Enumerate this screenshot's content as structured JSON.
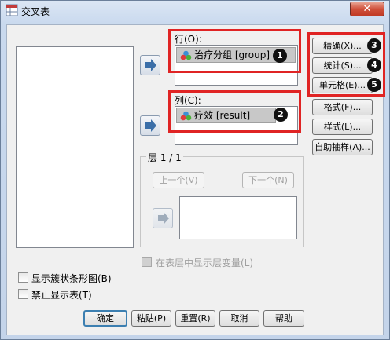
{
  "window": {
    "title": "交叉表",
    "close_glyph": "✕"
  },
  "rows_section": {
    "label": "行(O):",
    "variable": "治疗分组 [group]",
    "badge": "1"
  },
  "columns_section": {
    "label": "列(C):",
    "variable": "疗效 [result]",
    "badge": "2"
  },
  "side_buttons": [
    {
      "label": "精确(X)...",
      "badge": "3"
    },
    {
      "label": "统计(S)...",
      "badge": "4"
    },
    {
      "label": "单元格(E)...",
      "badge": "5"
    },
    {
      "label": "格式(F)..."
    },
    {
      "label": "样式(L)..."
    },
    {
      "label": "自助抽样(A)..."
    }
  ],
  "layer": {
    "title": "层 1 / 1",
    "prev_label": "上一个(V)",
    "next_label": "下一个(N)"
  },
  "layer_checkbox": {
    "label": "在表层中显示层变量(L)",
    "checked": false
  },
  "options": [
    {
      "label": "显示簇状条形图(B)",
      "checked": false
    },
    {
      "label": "禁止显示表(T)",
      "checked": false
    }
  ],
  "footer_buttons": [
    "确定",
    "粘贴(P)",
    "重置(R)",
    "取消",
    "帮助"
  ],
  "colors": {
    "highlight_red": "#e02424",
    "default_border": "#3c7fb1",
    "arrow_blue": "#3a6ea8"
  }
}
